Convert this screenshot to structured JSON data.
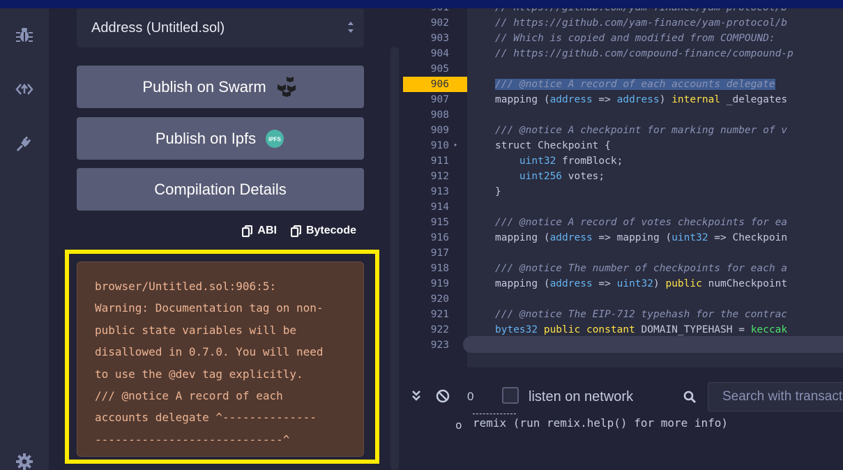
{
  "sidebar": {
    "icons": [
      "debug-icon",
      "udapp-icon",
      "plugin-icon",
      "settings-icon"
    ]
  },
  "compiler": {
    "contract_select": "Address (Untitled.sol)",
    "publish_swarm": "Publish on Swarm",
    "publish_ipfs": "Publish on Ipfs",
    "ipfs_badge": "IPFS",
    "compilation_details": "Compilation Details",
    "copy_abi": "ABI",
    "copy_bytecode": "Bytecode",
    "warning_lines": [
      "browser/Untitled.sol:906:5:",
      "Warning: Documentation tag on non-",
      "public state variables will be",
      "disallowed in 0.7.0. You will need",
      "to use the @dev tag explicitly.",
      "/// @notice A record of each",
      "accounts delegate ^--------------",
      "----------------------------^"
    ]
  },
  "editor": {
    "active_line": "906",
    "lines": [
      {
        "n": "901",
        "text": "// https://github.com/yam-finance/yam-protocol/b"
      },
      {
        "n": "902",
        "text": "// https://github.com/yam-finance/yam-protocol/b"
      },
      {
        "n": "903",
        "text": "// Which is copied and modified from COMPOUND:"
      },
      {
        "n": "904",
        "text": "// https://github.com/compound-finance/compound-p"
      },
      {
        "n": "905",
        "text": ""
      },
      {
        "n": "906",
        "text": "/// @notice A record of each accounts delegate"
      },
      {
        "n": "907",
        "text": "mapping (address => address) internal _delegates"
      },
      {
        "n": "908",
        "text": ""
      },
      {
        "n": "909",
        "text": "/// @notice A checkpoint for marking number of v"
      },
      {
        "n": "910",
        "text": "struct Checkpoint {"
      },
      {
        "n": "911",
        "text": "    uint32 fromBlock;"
      },
      {
        "n": "912",
        "text": "    uint256 votes;"
      },
      {
        "n": "913",
        "text": "}"
      },
      {
        "n": "914",
        "text": ""
      },
      {
        "n": "915",
        "text": "/// @notice A record of votes checkpoints for ea"
      },
      {
        "n": "916",
        "text": "mapping (address => mapping (uint32 => Checkpoin"
      },
      {
        "n": "917",
        "text": ""
      },
      {
        "n": "918",
        "text": "/// @notice The number of checkpoints for each a"
      },
      {
        "n": "919",
        "text": "mapping (address => uint32) public numCheckpoint"
      },
      {
        "n": "920",
        "text": ""
      },
      {
        "n": "921",
        "text": "/// @notice The EIP-712 typehash for the contrac"
      },
      {
        "n": "922",
        "text": "bytes32 public constant DOMAIN_TYPEHASH = keccak"
      },
      {
        "n": "923",
        "text": ""
      }
    ]
  },
  "terminal": {
    "pending_count": "0",
    "listen_label": "listen on network",
    "search_placeholder": "Search with transaction hash or address",
    "output_bullet": "o",
    "output_text": "remix (run remix.help() for more info)"
  },
  "colors": {
    "highlight": "#ffea00",
    "active_line": "#ffbf00",
    "warning_bg": "#513930",
    "warning_text": "#efb492"
  }
}
